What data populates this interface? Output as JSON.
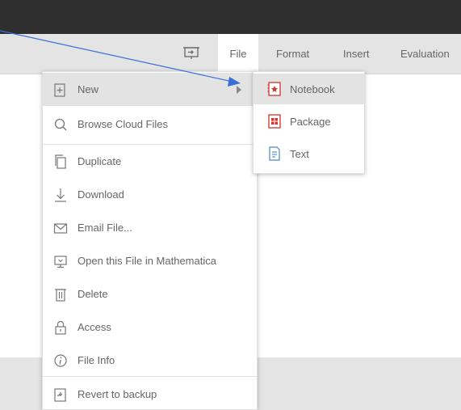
{
  "menubar": {
    "items": [
      {
        "label": "File"
      },
      {
        "label": "Format"
      },
      {
        "label": "Insert"
      },
      {
        "label": "Evaluation"
      }
    ]
  },
  "file_menu": {
    "items": [
      {
        "label": "New",
        "icon": "new-notebook-icon"
      },
      {
        "label": "Browse Cloud Files",
        "icon": "search-icon"
      },
      {
        "label": "Duplicate",
        "icon": "duplicate-icon"
      },
      {
        "label": "Download",
        "icon": "download-icon"
      },
      {
        "label": "Email File...",
        "icon": "email-icon"
      },
      {
        "label": "Open this File in Mathematica",
        "icon": "open-desktop-icon"
      },
      {
        "label": "Delete",
        "icon": "trash-icon"
      },
      {
        "label": "Access",
        "icon": "lock-icon"
      },
      {
        "label": "File Info",
        "icon": "info-icon"
      },
      {
        "label": "Revert to backup",
        "icon": "revert-icon"
      }
    ]
  },
  "new_submenu": {
    "items": [
      {
        "label": "Notebook",
        "icon": "notebook-icon"
      },
      {
        "label": "Package",
        "icon": "package-icon"
      },
      {
        "label": "Text",
        "icon": "text-file-icon"
      }
    ]
  },
  "colors": {
    "titlebar": "#2f2f2f",
    "menubar": "#e4e4e4",
    "highlight": "#e3e3e3",
    "pointer_arrow": "#3a6fd8",
    "wolfram_red": "#d0342c"
  }
}
